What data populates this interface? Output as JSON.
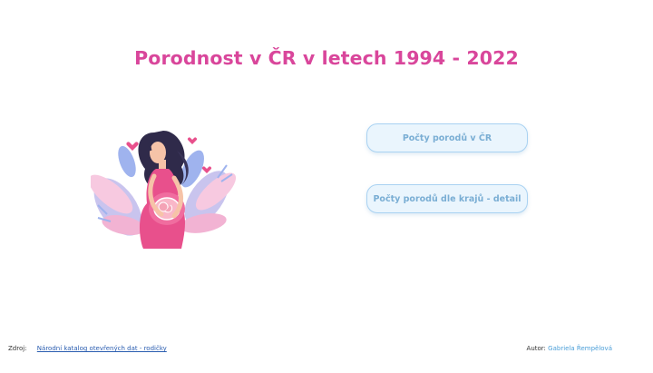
{
  "page": {
    "title": "Porodnost v ČR v letech 1994 - 2022"
  },
  "illustration": {
    "icon": "pregnant-woman-illustration"
  },
  "buttons": {
    "births_cr": "Počty porodů v ČR",
    "births_by_region": "Počty porodů dle krajů - detail"
  },
  "footer": {
    "source_label": "Zdroj:",
    "source_link": "Národní katalog otevřených dat - rodičky",
    "author_label": "Autor:",
    "author_name": "Gabriela Řempělová"
  },
  "colors": {
    "title": "#d9469b",
    "button_bg": "#eaf5fd",
    "button_border": "#a9d2f2",
    "button_text": "#7aaed4",
    "link": "#2a5db0",
    "author": "#4a9ed8"
  }
}
